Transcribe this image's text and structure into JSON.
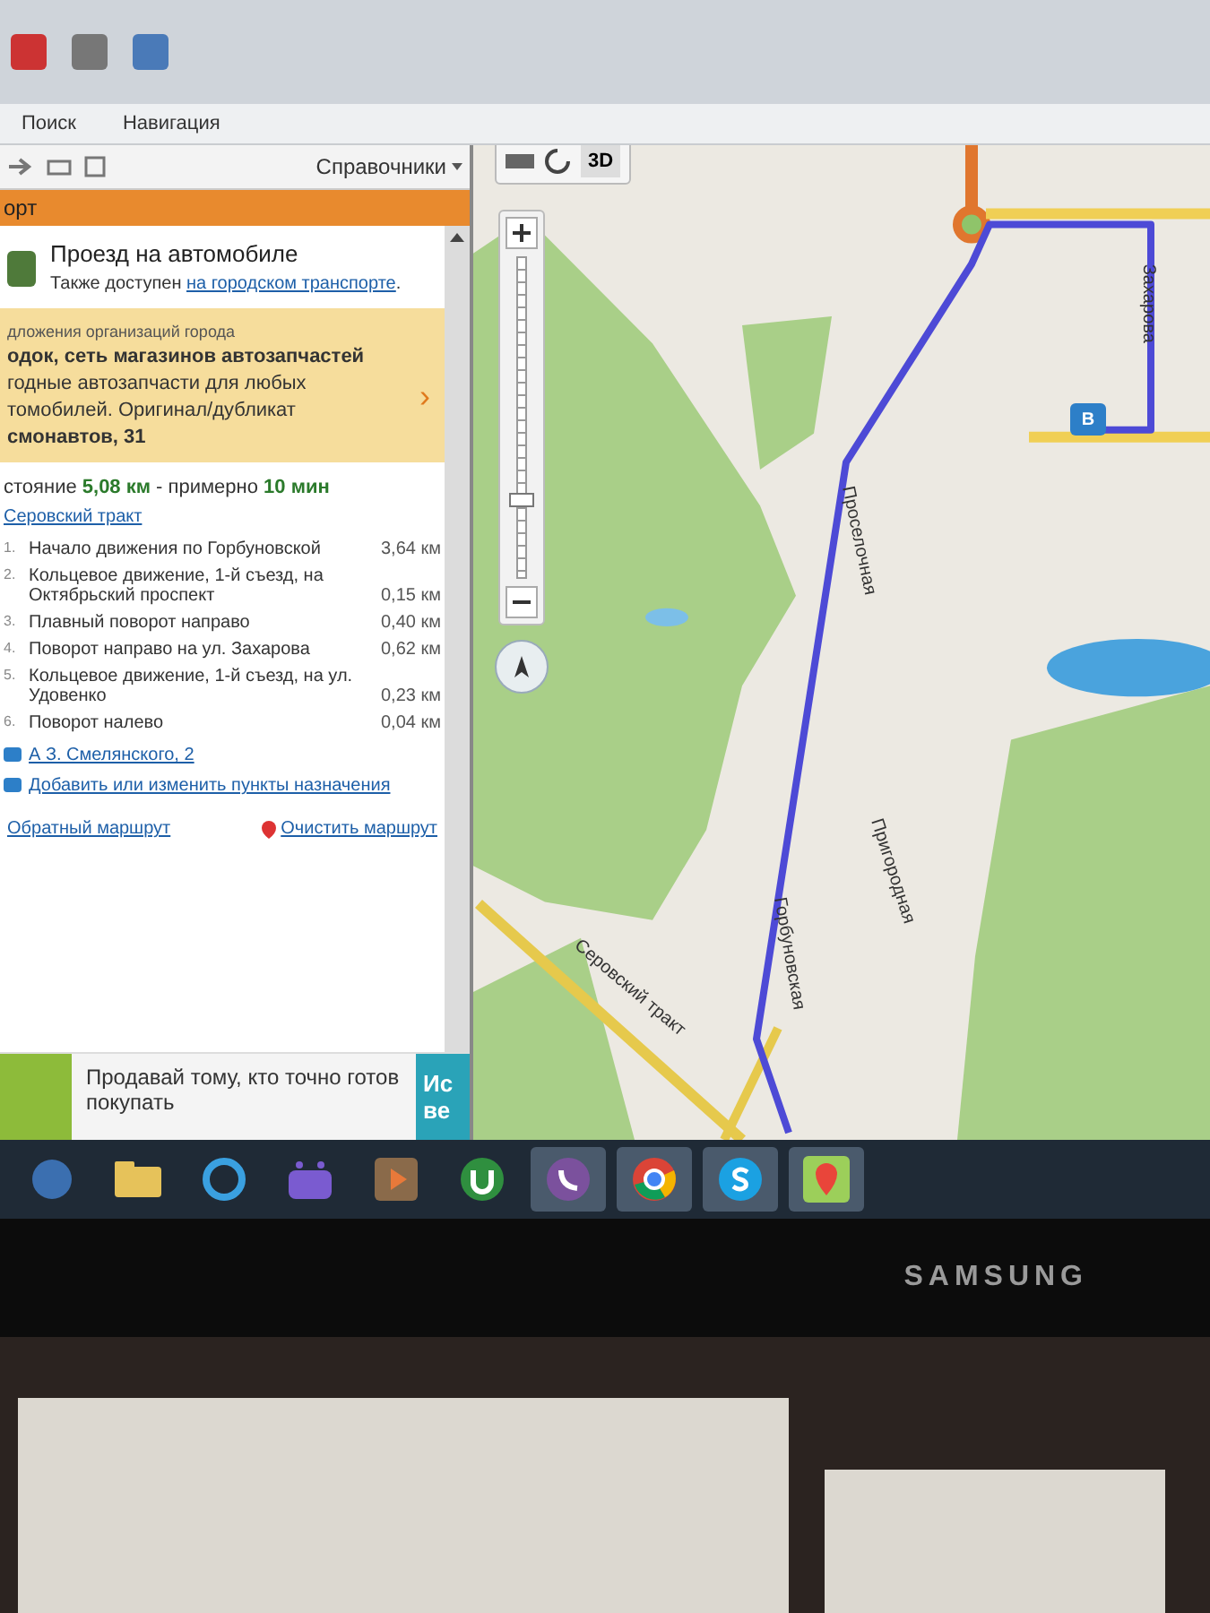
{
  "menu": [
    {
      "label": "Поиск"
    },
    {
      "label": "Навигация"
    }
  ],
  "toolbar": {
    "directory_menu": "Справочники"
  },
  "panel": {
    "header": "орт",
    "route_mode": {
      "title": "Проезд на автомобиле",
      "note": "Также доступен ",
      "link": "на городском транспорте",
      "suffix": "."
    },
    "ad": {
      "caption": "дложения организаций города",
      "title": "одок, сеть магазинов автозапчастей",
      "lines": [
        "годные автозапчасти для любых",
        "томобилей. Оригинал/дубликат"
      ],
      "address": "смонавтов, 31",
      "chevron": "›"
    },
    "summary": "стояние **5,08 км** - примерно **10 мин**",
    "via": "Серовский тракт",
    "steps": [
      {
        "number": "1.",
        "text": "Начало движения по Горбуновской",
        "distance": "3,64 км"
      },
      {
        "number": "2.",
        "text": "Кольцевое движение, 1-й съезд, на Октябрьский проспект",
        "distance": "0,15 км"
      },
      {
        "number": "3.",
        "text": "Плавный поворот направо",
        "distance": "0,40 км"
      },
      {
        "number": "4.",
        "text": "Поворот направо на ул. Захарова",
        "distance": "0,62 км"
      },
      {
        "number": "5.",
        "text": "Кольцевое движение, 1-й съезд, на ул. Удовенко",
        "distance": "0,23 км"
      },
      {
        "number": "6.",
        "text": "Поворот налево",
        "distance": "0,04 км"
      }
    ],
    "destination": "А З. Смелянского, 2",
    "edit_link": "Добавить или изменить пункты назначения",
    "reverse_link": "Обратный маршрут",
    "clear_link": "Очистить маршрут"
  },
  "banner": {
    "text": "Продавай тому, кто точно готов покупать",
    "button_lines": [
      "Ис",
      "ве"
    ]
  },
  "map": {
    "mode_3d": "3D",
    "marker": "B",
    "zoom": {
      "level": 0.25
    },
    "labels": [
      {
        "kind": "zakharova",
        "text": "Захарова"
      },
      {
        "kind": "proselochnaya",
        "text": "Проселочная"
      },
      {
        "kind": "prigorodnaya",
        "text": "Пригородная"
      },
      {
        "kind": "gorbunovskaya",
        "text": "Горбуновская"
      },
      {
        "kind": "serovsky",
        "text": "Серовский тракт"
      }
    ]
  },
  "taskbar": [
    {
      "kind": "start",
      "selected": false
    },
    {
      "kind": "folder",
      "selected": false
    },
    {
      "kind": "browser",
      "selected": false
    },
    {
      "kind": "media",
      "selected": false
    },
    {
      "kind": "player",
      "selected": false
    },
    {
      "kind": "torrent",
      "selected": false
    },
    {
      "kind": "phone",
      "selected": true
    },
    {
      "kind": "chrome",
      "selected": true
    },
    {
      "kind": "skype",
      "selected": true
    },
    {
      "kind": "map",
      "selected": true
    }
  ],
  "monitor": {
    "brand": "SAMSUNG"
  }
}
